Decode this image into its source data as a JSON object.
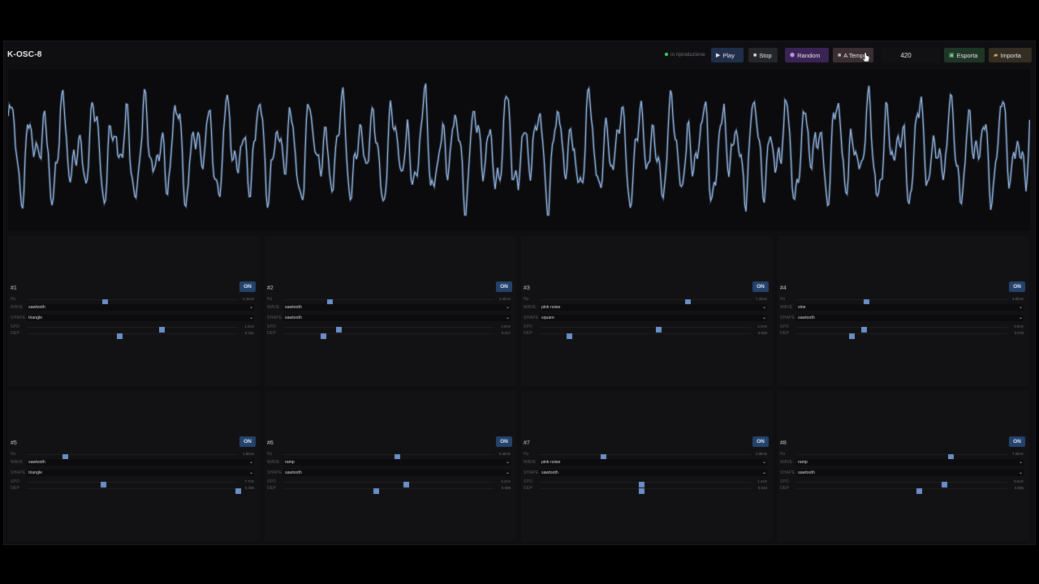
{
  "app": {
    "title": "K-OSC-8"
  },
  "toolbar": {
    "status_text": "in riproduzione",
    "status_color": "#3ecf6a",
    "play_label": "Play",
    "play_icon": "play-icon",
    "stop_label": "Stop",
    "stop_icon": "stop-icon",
    "random_label": "Random",
    "random_icon": "dice-icon",
    "atempo_label": "A Tempo",
    "atempo_icon": "square-icon",
    "bpm_value": "420",
    "esporta_label": "Esporta",
    "esporta_icon": "save-icon",
    "importa_label": "Importa",
    "importa_icon": "folder-icon"
  },
  "labels": {
    "hz": "Hz",
    "wave": "WAVE",
    "shape": "SHAPE",
    "spd": "SPD",
    "dep": "DEP",
    "on": "ON"
  },
  "colors": {
    "accent": "#6a8fc4",
    "waveform": "#8fb3e0",
    "on_button": "#24426b"
  },
  "oscillators": [
    {
      "id": "#1",
      "hz_label": "4.1kHz",
      "hz_level": 0.37,
      "wave": "sawtooth",
      "shape": "triangle",
      "spd_label": "1.5Hz",
      "spd_level": 0.64,
      "dep_label": "0.441",
      "dep_level": 0.44
    },
    {
      "id": "#2",
      "hz_label": "2.4kHz",
      "hz_level": 0.22,
      "wave": "sawtooth",
      "shape": "sawtooth",
      "spd_label": "2.0Hz",
      "spd_level": 0.26,
      "dep_label": "0.017",
      "dep_level": 0.19
    },
    {
      "id": "#3",
      "hz_label": "7.1kHz",
      "hz_level": 0.7,
      "wave": "pink noise",
      "shape": "square",
      "spd_label": "4.0Hz",
      "spd_level": 0.56,
      "dep_label": "0.029",
      "dep_level": 0.14
    },
    {
      "id": "#4",
      "hz_label": "3.0kHz",
      "hz_level": 0.33,
      "wave": "sine",
      "shape": "sawtooth",
      "spd_label": "0.8Hz",
      "spd_level": 0.32,
      "dep_label": "0.078",
      "dep_level": 0.26
    },
    {
      "id": "#5",
      "hz_label": "1.5kHz",
      "hz_level": 0.18,
      "wave": "sawtooth",
      "shape": "triangle",
      "spd_label": "7.7Hz",
      "spd_level": 0.36,
      "dep_label": "0.400",
      "dep_level": 1.0
    },
    {
      "id": "#6",
      "hz_label": "5.4kHz",
      "hz_level": 0.54,
      "wave": "ramp",
      "shape": "sawtooth",
      "spd_label": "4.2Hz",
      "spd_level": 0.58,
      "dep_label": "0.058",
      "dep_level": 0.44
    },
    {
      "id": "#7",
      "hz_label": "2.0kHz",
      "hz_level": 0.3,
      "wave": "pink noise",
      "shape": "sawtooth",
      "spd_label": "1.4Hz",
      "spd_level": 0.48,
      "dep_label": "0.043",
      "dep_level": 0.48
    },
    {
      "id": "#8",
      "hz_label": "7.2kHz",
      "hz_level": 0.73,
      "wave": "ramp",
      "shape": "sawtooth",
      "spd_label": "5.5Hz",
      "spd_level": 0.7,
      "dep_label": "0.005",
      "dep_level": 0.58
    }
  ]
}
